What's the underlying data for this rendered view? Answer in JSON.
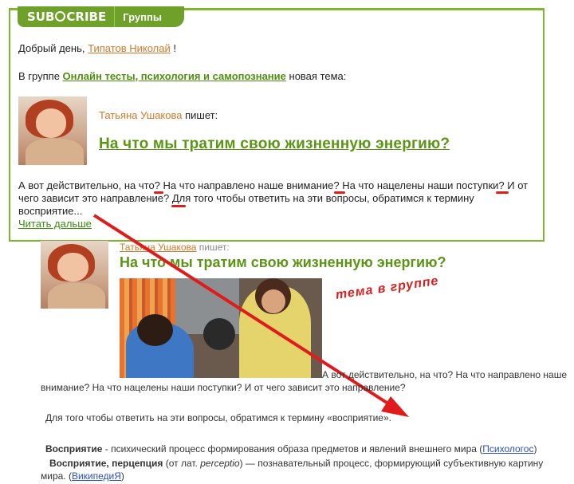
{
  "header": {
    "logo_text_1": "SUB",
    "logo_text_2": "CRIBE",
    "groups_label": "Группы"
  },
  "email": {
    "greeting_prefix": "Добрый день,",
    "user_name": "Типатов Николай",
    "greeting_suffix": "!",
    "group_prefix": "В группе",
    "group_name": "Онлайн тесты, психология и самопознание",
    "group_suffix": "новая тема:",
    "author_name": "Татьяна Ушакова",
    "author_writes": "пишет:",
    "topic_title": "На что мы тратим свою жизненную энергию?",
    "body_text": "А вот действительно, на что? На что направлено наше внимание? На что нацелены наши поступки? И от чего зависит это направление? Для того чтобы ответить на эти вопросы, обратимся к термину восприятие...",
    "read_more": "Читать дальше"
  },
  "topic_page": {
    "author_name": "Татьяна Ушакова",
    "author_writes": "пишет:",
    "title": "На что мы тратим свою жизненную энергию?",
    "intro_text": "А вот действительно, на что? На что направлено наше внимание? На что нацелены наши поступки? И от чего зависит это направление?",
    "para2": "Для того чтобы ответить на эти вопросы, обратимся к термину «восприятие».",
    "def1_term": "Восприятие",
    "def1_text": "- психический процесс формирования образа предметов и явлений внешнего мира (",
    "def1_source": "Психологос",
    "def1_end": ")",
    "def2_term": "Восприятие, перцепция",
    "def2_text_a": "(от лат.",
    "def2_latin": "perceptio",
    "def2_text_b": ") — познавательный процесс, формирующий субъективную картину мира. (",
    "def2_source": "ВикипедиЯ",
    "def2_end": ")"
  },
  "annotation": "тема в группе",
  "colors": {
    "accent_green": "#6ea02a",
    "link_orange": "#cf7a2a",
    "title_green": "#5b9515",
    "annotation_red": "#d91e1e"
  }
}
